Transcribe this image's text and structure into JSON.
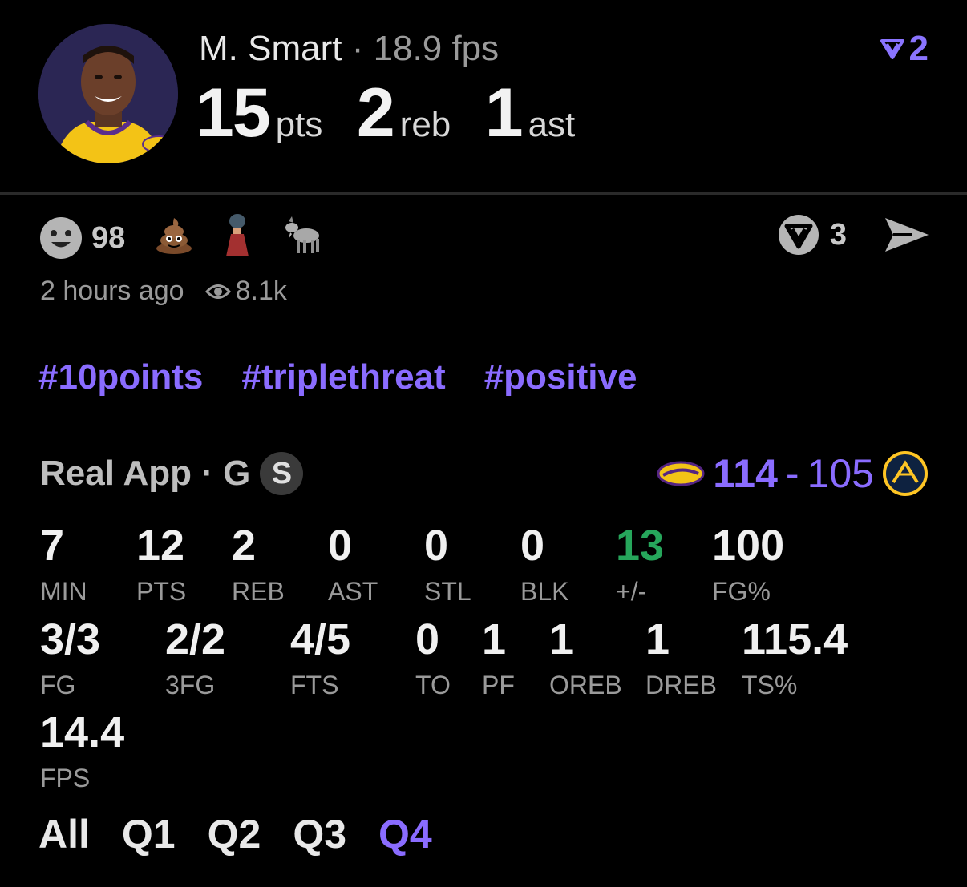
{
  "header": {
    "player_name": "M. Smart",
    "separator": "·",
    "fps": "18.9 fps",
    "pts_value": "15",
    "pts_unit": "pts",
    "reb_value": "2",
    "reb_unit": "reb",
    "ast_value": "1",
    "ast_unit": "ast",
    "vote_count": "2"
  },
  "reactions": {
    "smiley_count": "98",
    "items": [
      "poop-emoji",
      "person-emoji",
      "goat-emoji"
    ],
    "real_count": "3"
  },
  "meta": {
    "time_ago": "2 hours ago",
    "views": "8.1k"
  },
  "hashtags": [
    "#10points",
    "#triplethreat",
    "#positive"
  ],
  "game": {
    "source": "Real App · G",
    "badge": "S",
    "home_score": "114",
    "dash": "-",
    "away_score": "105",
    "home_team_color": "#552583",
    "away_team_color": "#FEC524"
  },
  "stats_row1": [
    {
      "value": "7",
      "label": "MIN"
    },
    {
      "value": "12",
      "label": "PTS"
    },
    {
      "value": "2",
      "label": "REB"
    },
    {
      "value": "0",
      "label": "AST"
    },
    {
      "value": "0",
      "label": "STL"
    },
    {
      "value": "0",
      "label": "BLK"
    },
    {
      "value": "13",
      "label": "+/-"
    },
    {
      "value": "100",
      "label": "FG%"
    }
  ],
  "stats_row2": [
    {
      "value": "3/3",
      "label": "FG"
    },
    {
      "value": "2/2",
      "label": "3FG"
    },
    {
      "value": "4/5",
      "label": "FTS"
    },
    {
      "value": "0",
      "label": "TO"
    },
    {
      "value": "1",
      "label": "PF"
    },
    {
      "value": "1",
      "label": "OREB"
    },
    {
      "value": "1",
      "label": "DREB"
    },
    {
      "value": "115.4",
      "label": "TS%"
    }
  ],
  "stats_row3": [
    {
      "value": "14.4",
      "label": "FPS"
    }
  ],
  "tabs": [
    "All",
    "Q1",
    "Q2",
    "Q3",
    "Q4"
  ],
  "active_tab": "Q4",
  "colors": {
    "accent": "#8a6cff",
    "positive": "#26a65b"
  }
}
